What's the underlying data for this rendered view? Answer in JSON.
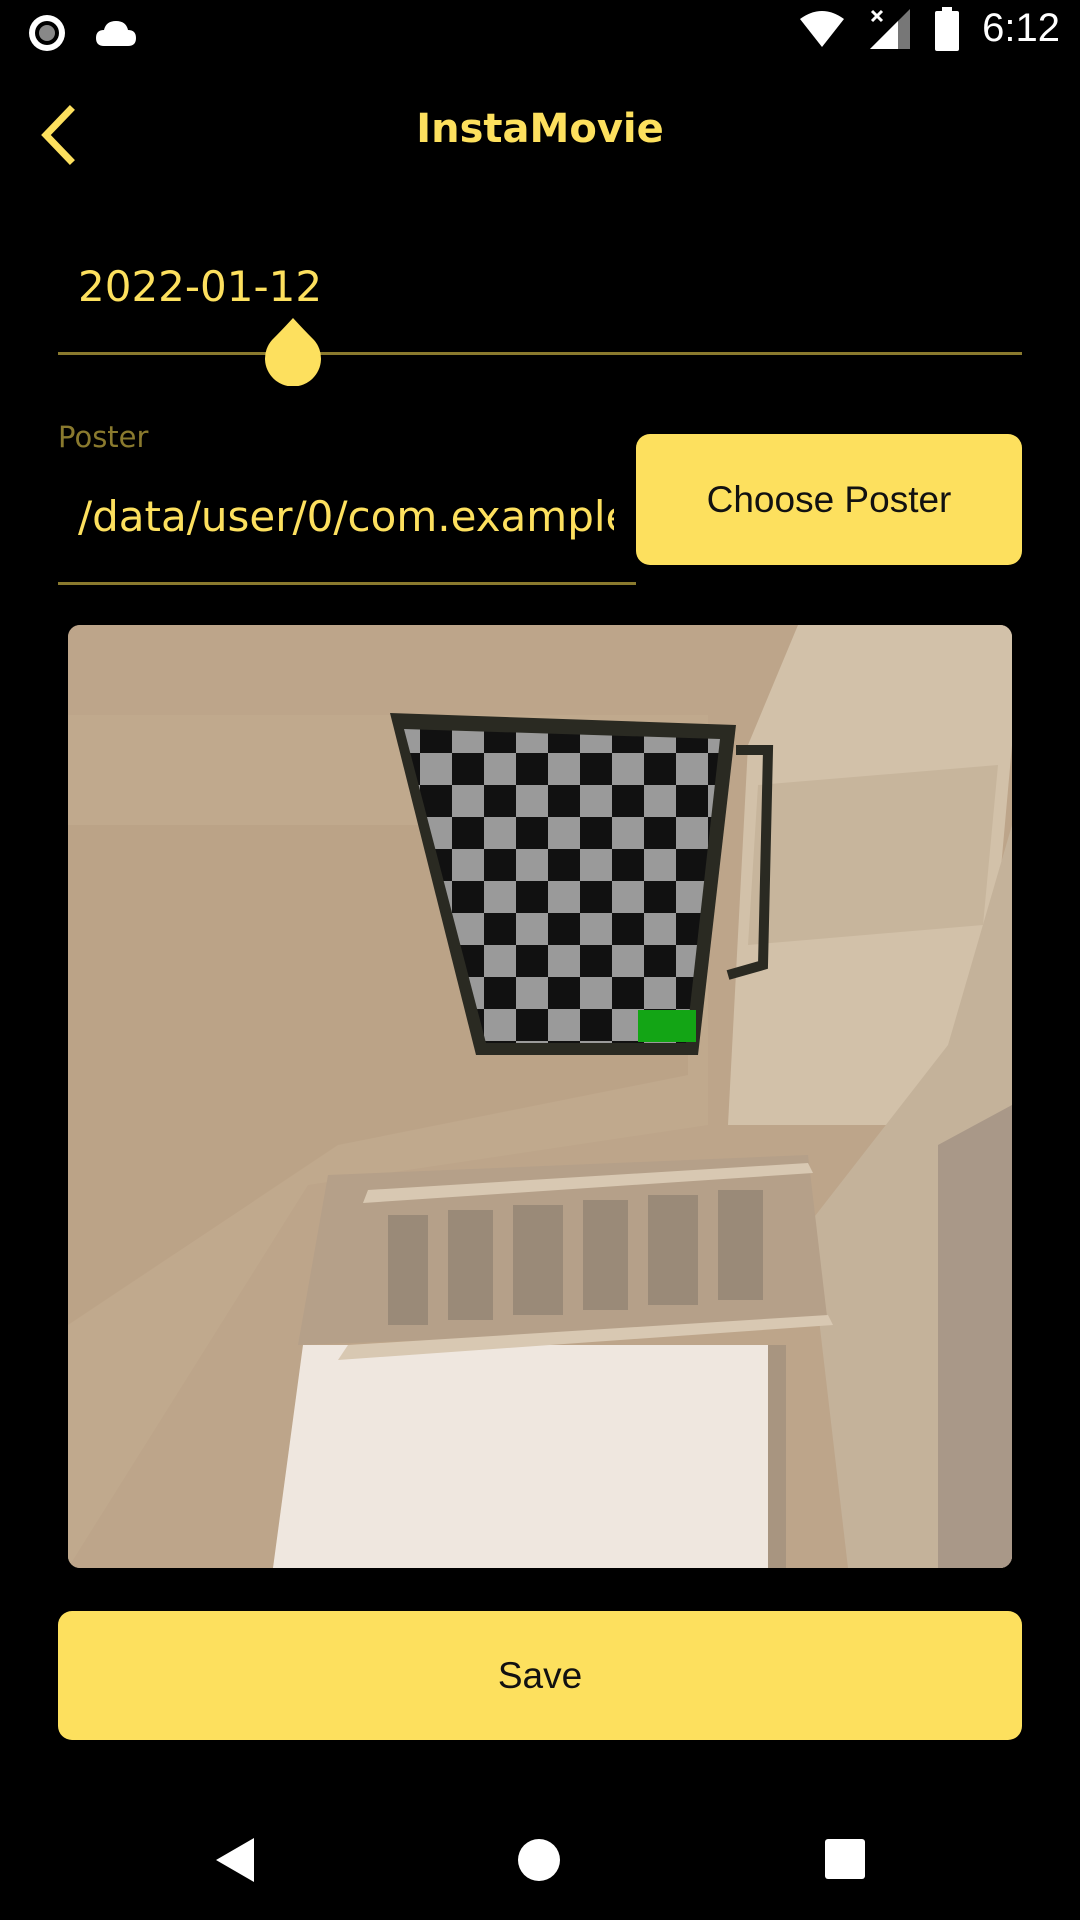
{
  "status_bar": {
    "time": "6:12",
    "icons": [
      "record-icon",
      "cloud-icon",
      "wifi-icon",
      "signal-icon",
      "battery-icon"
    ]
  },
  "app_bar": {
    "title": "InstaMovie",
    "back_icon": "chevron-left-icon"
  },
  "date_slider": {
    "value_label": "2022-01-12"
  },
  "poster_field": {
    "label": "Poster",
    "value": "/data/user/0/com.example"
  },
  "buttons": {
    "choose_poster": "Choose Poster",
    "save": "Save"
  },
  "colors": {
    "accent": "#fde05e",
    "muted_accent": "#8a7a2e",
    "background": "#000000"
  },
  "nav_bar": {
    "icons": [
      "nav-back-icon",
      "nav-home-icon",
      "nav-recents-icon"
    ]
  }
}
